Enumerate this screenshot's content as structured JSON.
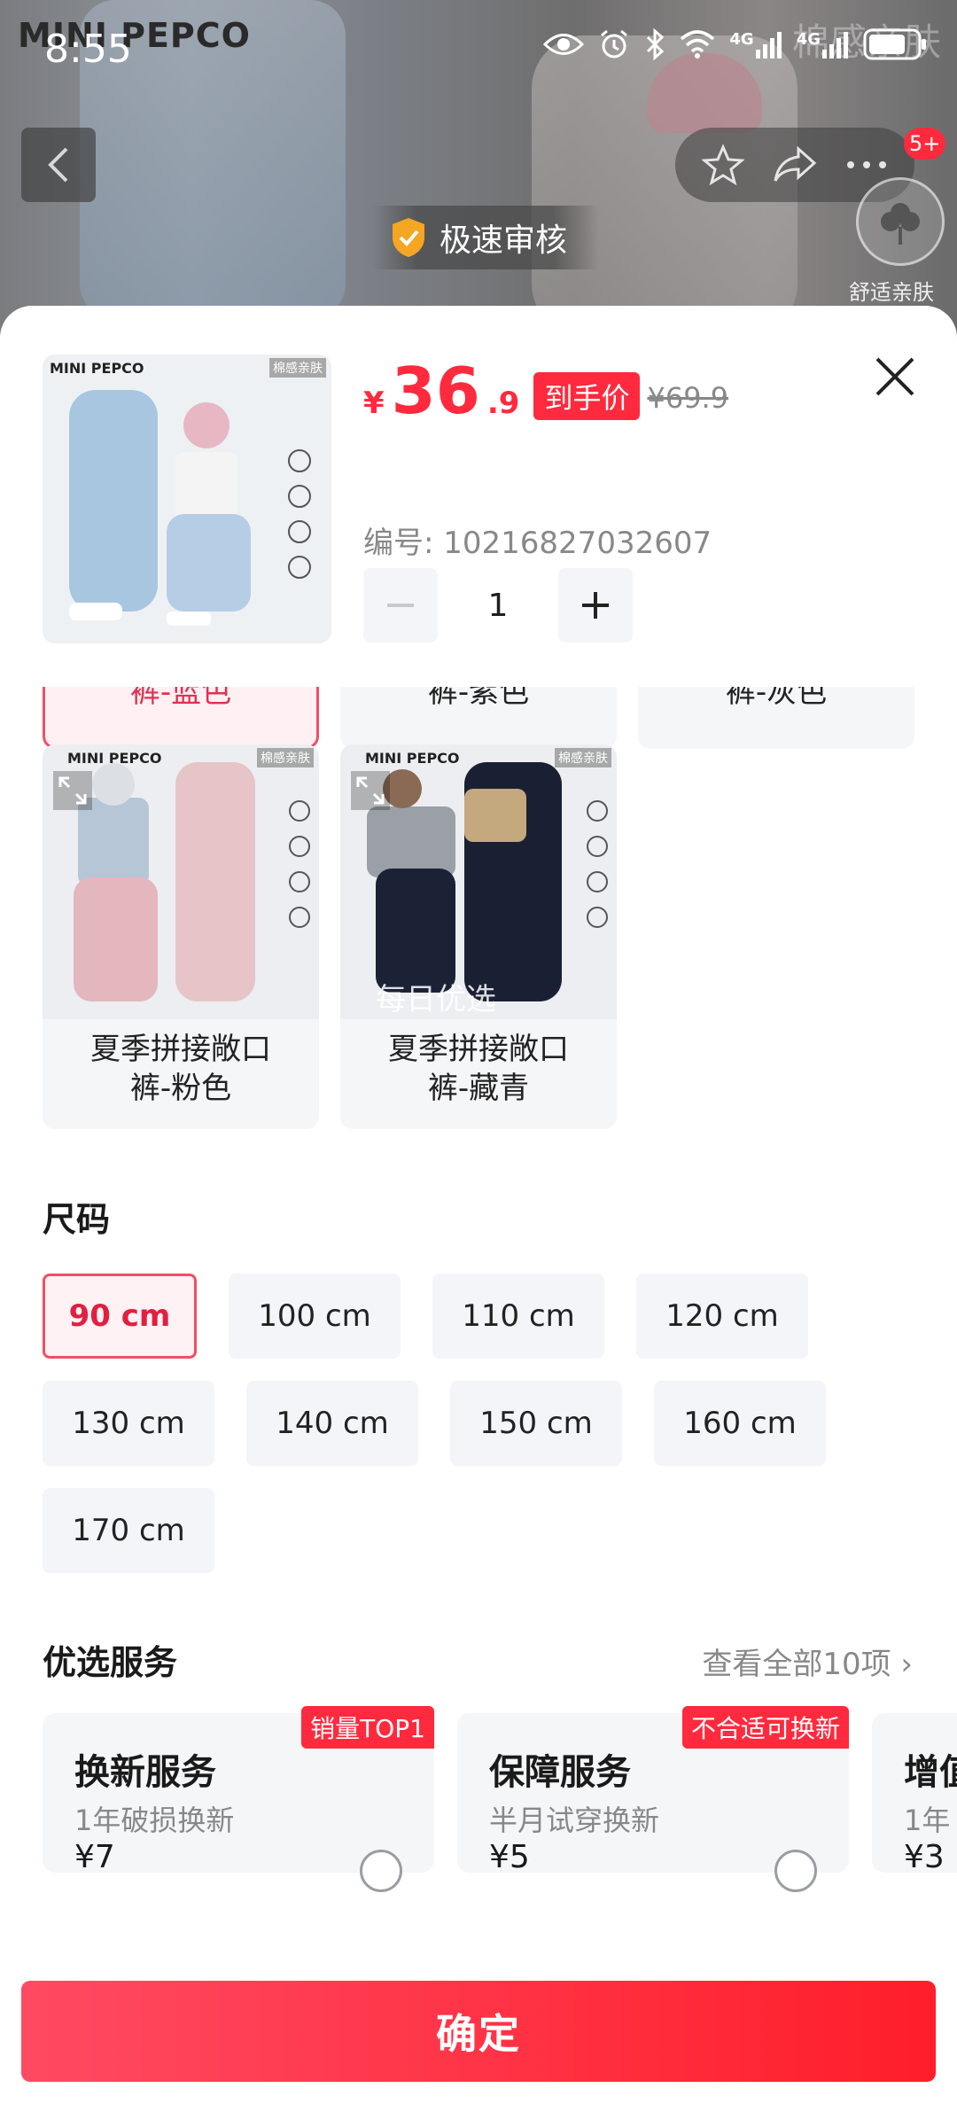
{
  "status_bar": {
    "time": "8:55",
    "network_1": "4G",
    "network_2": "4G"
  },
  "background": {
    "brand": "MINI PEPCO",
    "ghost_text": "棉感亲肤"
  },
  "header": {
    "cart_badge": "5+",
    "fast_review": "极速审核",
    "cotton_label": "舒适亲肤"
  },
  "product": {
    "price_symbol": "¥",
    "price_int": "36",
    "price_dec": ".9",
    "price_tag": "到手价",
    "original_price": "¥69.9",
    "sku_label": "编号: 10216827032607",
    "quantity": "1",
    "thumb_brand": "MINI PEPCO",
    "thumb_tag": "棉感亲肤"
  },
  "colors": {
    "partial": [
      {
        "label": "裤-蓝色",
        "selected": true
      },
      {
        "label": "裤-紫色",
        "selected": false
      },
      {
        "label": "裤-灰色",
        "selected": false
      }
    ],
    "cards": [
      {
        "line1": "夏季拼接敞口",
        "line2": "裤-粉色",
        "brand": "MINI PEPCO",
        "tag": "棉感亲肤"
      },
      {
        "line1": "夏季拼接敞口",
        "line2": "裤-藏青",
        "brand": "MINI PEPCO",
        "tag": "棉感亲肤",
        "watermark": "每日优选"
      }
    ]
  },
  "size": {
    "title": "尺码",
    "options": [
      "90 cm",
      "100 cm",
      "110 cm",
      "120 cm",
      "130 cm",
      "140 cm",
      "150 cm",
      "160 cm",
      "170 cm"
    ],
    "selected": "90 cm"
  },
  "services": {
    "title": "优选服务",
    "see_all": "查看全部10项 ›",
    "items": [
      {
        "title": "换新服务",
        "desc": "1年破损换新",
        "price": "¥7",
        "ribbon": "销量TOP1"
      },
      {
        "title": "保障服务",
        "desc": "半月试穿换新",
        "price": "¥5",
        "ribbon": "不合适可换新"
      },
      {
        "title": "增值",
        "desc": "1年",
        "price": "¥3",
        "ribbon": ""
      }
    ]
  },
  "confirm_button": "确定",
  "colors_theme": {
    "accent": "#ff2a3d",
    "selected_border": "#f04f66"
  }
}
